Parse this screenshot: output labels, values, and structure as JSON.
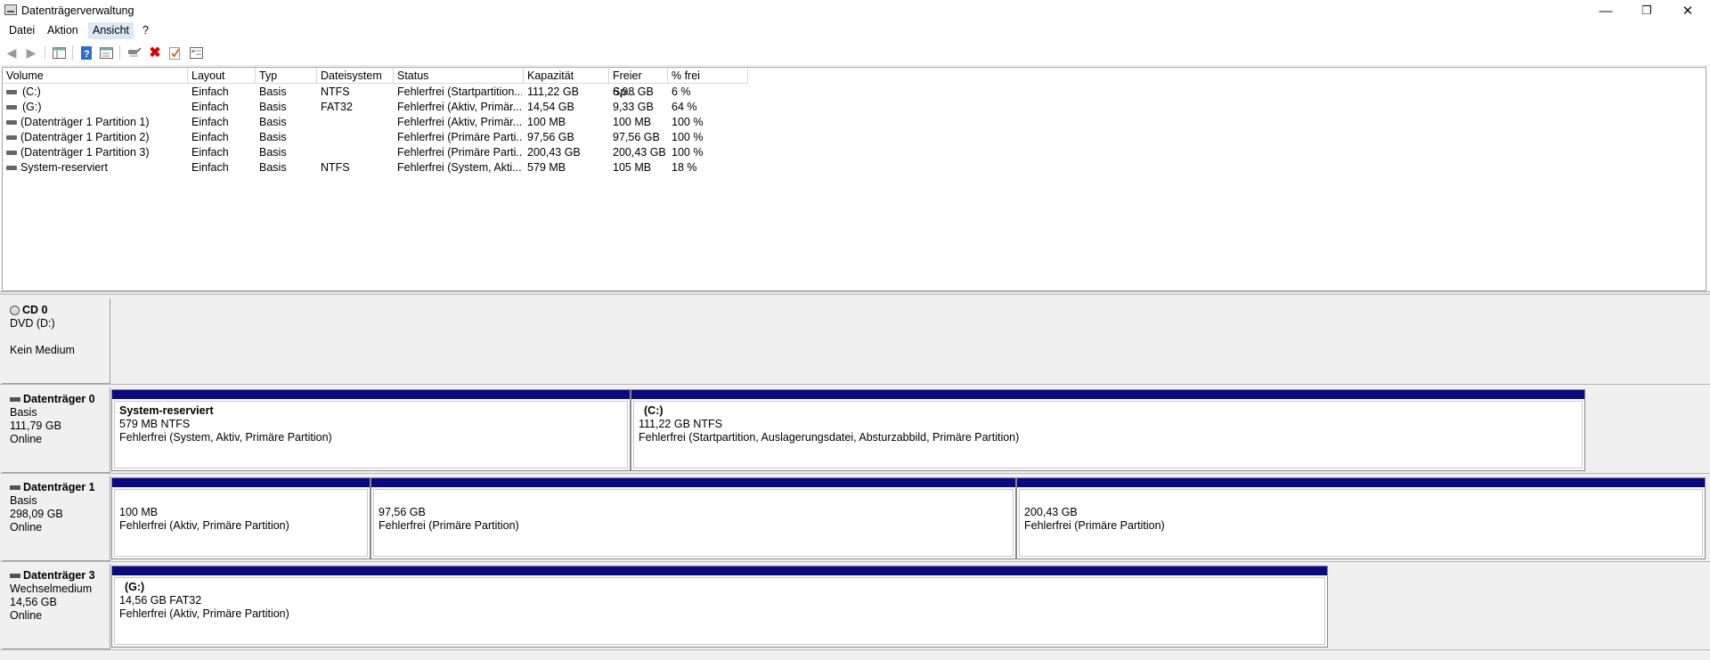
{
  "window": {
    "title": "Datenträgerverwaltung",
    "minimize": "—",
    "restore": "❐",
    "close": "✕"
  },
  "menu": [
    "Datei",
    "Aktion",
    "Ansicht",
    "?"
  ],
  "table": {
    "columns": [
      "Volume",
      "Layout",
      "Typ",
      "Dateisystem",
      "Status",
      "Kapazität",
      "Freier Sp...",
      "% frei"
    ],
    "rows": [
      [
        "(C:)",
        "Einfach",
        "Basis",
        "NTFS",
        "Fehlerfrei (Startpartition...",
        "111,22 GB",
        "6,98 GB",
        "6 %"
      ],
      [
        "(G:)",
        "Einfach",
        "Basis",
        "FAT32",
        "Fehlerfrei (Aktiv, Primär...",
        "14,54 GB",
        "9,33 GB",
        "64 %"
      ],
      [
        "(Datenträger 1 Partition 1)",
        "Einfach",
        "Basis",
        "",
        "Fehlerfrei (Aktiv, Primär...",
        "100 MB",
        "100 MB",
        "100 %"
      ],
      [
        "(Datenträger 1 Partition 2)",
        "Einfach",
        "Basis",
        "",
        "Fehlerfrei (Primäre Parti...",
        "97,56 GB",
        "97,56 GB",
        "100 %"
      ],
      [
        "(Datenträger 1 Partition 3)",
        "Einfach",
        "Basis",
        "",
        "Fehlerfrei (Primäre Parti...",
        "200,43 GB",
        "200,43 GB",
        "100 %"
      ],
      [
        "System-reserviert",
        "Einfach",
        "Basis",
        "NTFS",
        "Fehlerfrei (System, Akti...",
        "579 MB",
        "105 MB",
        "18 %"
      ]
    ]
  },
  "disks": {
    "cd0": {
      "name": "CD 0",
      "line1": "DVD (D:)",
      "line2": "",
      "line3": "Kein Medium"
    },
    "d0": {
      "name": "Datenträger 0",
      "type": "Basis",
      "size": "111,79 GB",
      "state": "Online",
      "p1": {
        "name": "System-reserviert",
        "size": "579 MB NTFS",
        "status": "Fehlerfrei (System, Aktiv, Primäre Partition)"
      },
      "p2": {
        "name": "(C:)",
        "size": "111,22 GB NTFS",
        "status": "Fehlerfrei (Startpartition, Auslagerungsdatei, Absturzabbild, Primäre Partition)"
      }
    },
    "d1": {
      "name": "Datenträger 1",
      "type": "Basis",
      "size": "298,09 GB",
      "state": "Online",
      "p1": {
        "size": "100 MB",
        "status": "Fehlerfrei (Aktiv, Primäre Partition)"
      },
      "p2": {
        "size": "97,56 GB",
        "status": "Fehlerfrei (Primäre Partition)"
      },
      "p3": {
        "size": "200,43 GB",
        "status": "Fehlerfrei (Primäre Partition)"
      }
    },
    "d3": {
      "name": "Datenträger 3",
      "type": "Wechselmedium",
      "size": "14,56 GB",
      "state": "Online",
      "p1": {
        "name": "(G:)",
        "size": "14,56 GB FAT32",
        "status": "Fehlerfrei (Aktiv, Primäre Partition)"
      }
    }
  },
  "colors": {
    "partition_bar": "#0a0a80",
    "menu_active": "#dbe9f7",
    "panel_bg": "#f0f0f0"
  },
  "icons": {
    "back": "back-arrow-icon",
    "forward": "forward-arrow-icon",
    "console": "console-tree-icon",
    "help": "help-icon",
    "properties": "properties-icon",
    "connect": "connect-icon",
    "delete": "delete-icon",
    "check": "check-icon",
    "settings": "settings-icon"
  }
}
